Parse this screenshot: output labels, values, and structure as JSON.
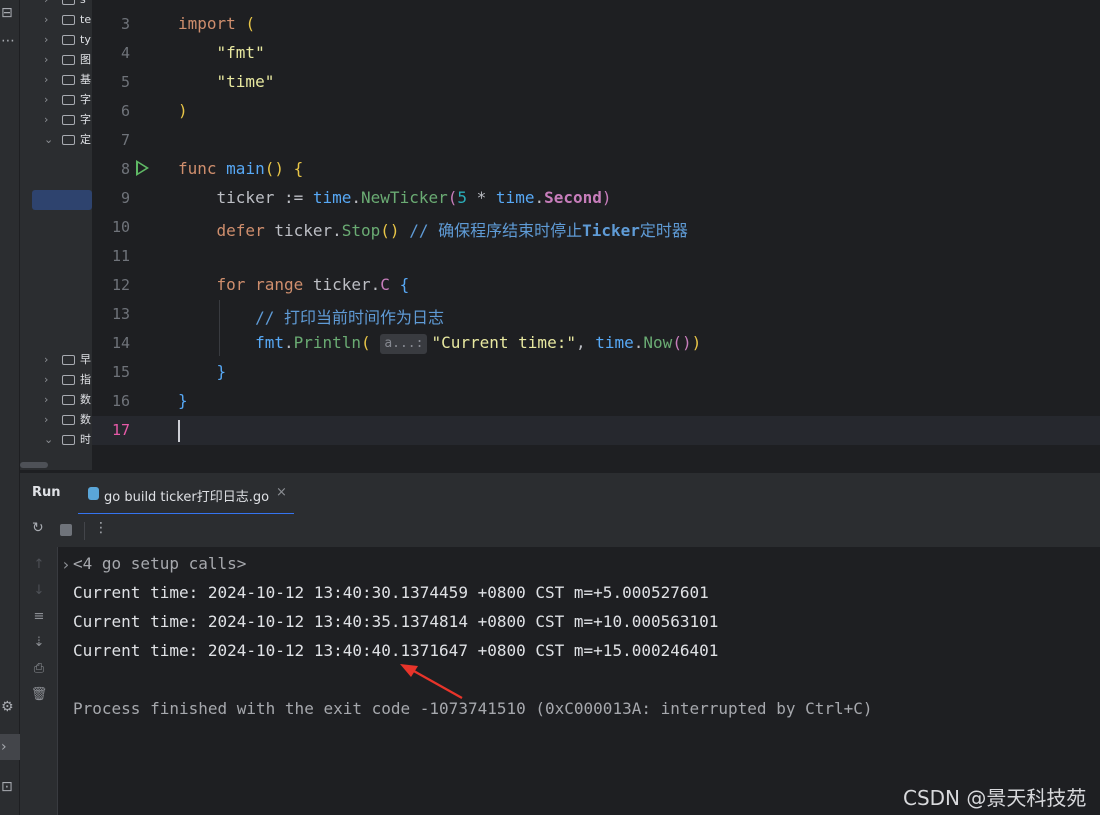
{
  "tree": {
    "items": [
      {
        "chev": "›",
        "name": "s"
      },
      {
        "chev": "›",
        "name": "te"
      },
      {
        "chev": "›",
        "name": "ty"
      },
      {
        "chev": "›",
        "name": "图"
      },
      {
        "chev": "›",
        "name": "基"
      },
      {
        "chev": "›",
        "name": "字"
      },
      {
        "chev": "›",
        "name": "字"
      },
      {
        "chev": "⌄",
        "name": "定"
      },
      {
        "chev": "›",
        "name": "早"
      },
      {
        "chev": "›",
        "name": "指"
      },
      {
        "chev": "›",
        "name": "数"
      },
      {
        "chev": "›",
        "name": "数"
      },
      {
        "chev": "⌄",
        "name": "时"
      }
    ]
  },
  "editor": {
    "line_numbers": [
      "3",
      "4",
      "5",
      "6",
      "7",
      "8",
      "9",
      "10",
      "11",
      "12",
      "13",
      "14",
      "15",
      "16",
      "17"
    ],
    "current_line": "17",
    "code": {
      "l3_kw": "import",
      "l3_paren": "(",
      "l4_str": "\"fmt\"",
      "l5_str": "\"time\"",
      "l6_paren": ")",
      "l8_kw": "func",
      "l8_fn": "main",
      "l8_parens": "()",
      "l8_brace": "{",
      "l9_var": "ticker",
      "l9_op": " := ",
      "l9_pkg": "time",
      "l9_dot": ".",
      "l9_fn": "NewTicker",
      "l9_open": "(",
      "l9_num": "5",
      "l9_mul": " * ",
      "l9_pkg2": "time",
      "l9_dot2": ".",
      "l9_mem": "Second",
      "l9_close": ")",
      "l10_kw": "defer",
      "l10_var": " ticker.",
      "l10_fn": "Stop",
      "l10_parens": "()",
      "l10_cmt": " // 确保程序结束时停止",
      "l10_cmt_bold": "Ticker",
      "l10_cmt2": "定时器",
      "l12_kw": "for range",
      "l12_var": " ticker.",
      "l12_fld": "C",
      "l12_brace": " {",
      "l13_cmt": "// 打印当前时间作为日志",
      "l14_pkg": "fmt",
      "l14_dot": ".",
      "l14_fn": "Println",
      "l14_open": "(",
      "l14_hint": "a...:",
      "l14_str": "\"Current time:\"",
      "l14_comma": ", ",
      "l14_pkg2": "time",
      "l14_dot2": ".",
      "l14_fn2": "Now",
      "l14_inner": "()",
      "l14_close": ")",
      "l15_brace": "}",
      "l16_brace": "}"
    }
  },
  "run": {
    "title": "Run",
    "tab_label": "go build ticker打印日志.go",
    "close_icon": "×",
    "more_icon": "⋮",
    "rerun_icon": "↻"
  },
  "side_actions": [
    "↑",
    "↓",
    "≡",
    "⇣",
    "⎙",
    "🗑"
  ],
  "console": {
    "setup": "<4 go setup calls>",
    "lines": [
      "Current time: 2024-10-12 13:40:30.1374459 +0800 CST m=+5.000527601",
      "Current time: 2024-10-12 13:40:35.1374814 +0800 CST m=+10.000563101",
      "Current time: 2024-10-12 13:40:40.1371647 +0800 CST m=+15.000246401"
    ],
    "exit": "Process finished with the exit code -1073741510 (0xC000013A: interrupted by Ctrl+C)"
  },
  "watermark": "CSDN @景天科技苑",
  "colors": {
    "accent": "#3574f0",
    "annotation_arrow": "#e8342a",
    "run_green": "#5fb865"
  }
}
